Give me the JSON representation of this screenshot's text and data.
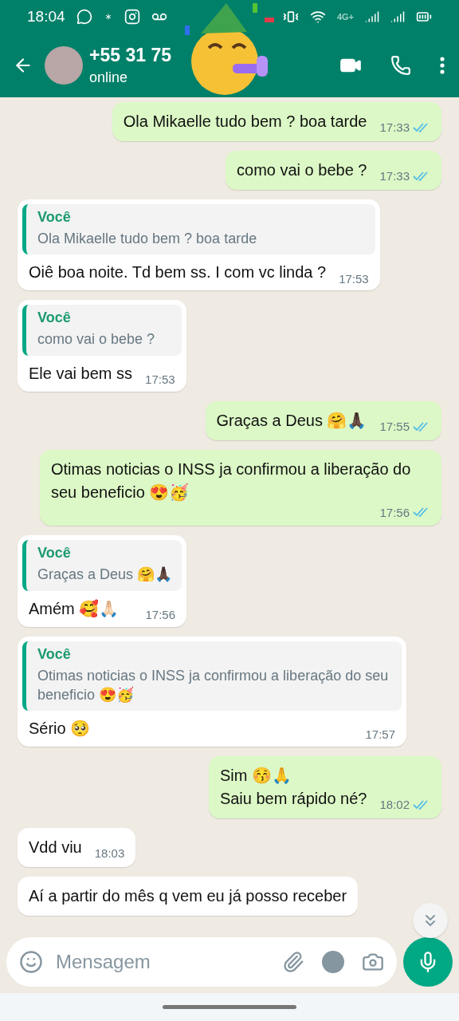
{
  "status_bar": {
    "time": "18:04",
    "network": "4G+"
  },
  "header": {
    "contact": "+55 31 75",
    "presence": "online"
  },
  "messages": [
    {
      "kind": "out",
      "text": "Ola Mikaelle tudo bem ? boa tarde",
      "time": "17:33",
      "read": true
    },
    {
      "kind": "out",
      "text": "como vai o bebe ?",
      "time": "17:33",
      "read": true
    },
    {
      "kind": "in",
      "quote": {
        "author": "Você",
        "text": "Ola Mikaelle tudo bem ? boa tarde"
      },
      "text": "Oiê boa noite. Td bem ss. I com vc linda ?",
      "time": "17:53"
    },
    {
      "kind": "in",
      "quote": {
        "author": "Você",
        "text": "como vai o bebe ?"
      },
      "text": "Ele vai bem ss",
      "time": "17:53"
    },
    {
      "kind": "out",
      "text": "Graças a Deus 🤗🙏🏿",
      "time": "17:55",
      "read": true
    },
    {
      "kind": "out",
      "text": "Otimas noticias o INSS ja confirmou a liberação do seu beneficio 😍🥳",
      "time": "17:56",
      "read": true
    },
    {
      "kind": "in",
      "quote": {
        "author": "Você",
        "text": "Graças a Deus 🤗🙏🏿"
      },
      "text": "Amém 🥰🙏🏻",
      "time": "17:56"
    },
    {
      "kind": "in",
      "quote": {
        "author": "Você",
        "text": "Otimas noticias o INSS ja confirmou a liberação do seu beneficio 😍🥳"
      },
      "text": "Sério 🥺",
      "time": "17:57"
    },
    {
      "kind": "out",
      "text": "Sim 😚🙏\nSaiu bem rápido né?",
      "time": "18:02",
      "read": true
    },
    {
      "kind": "in",
      "text": "Vdd viu",
      "time": "18:03"
    },
    {
      "kind": "in",
      "text": "Aí a partir do mês q vem eu já posso receber"
    }
  ],
  "composer": {
    "placeholder": "Mensagem"
  }
}
